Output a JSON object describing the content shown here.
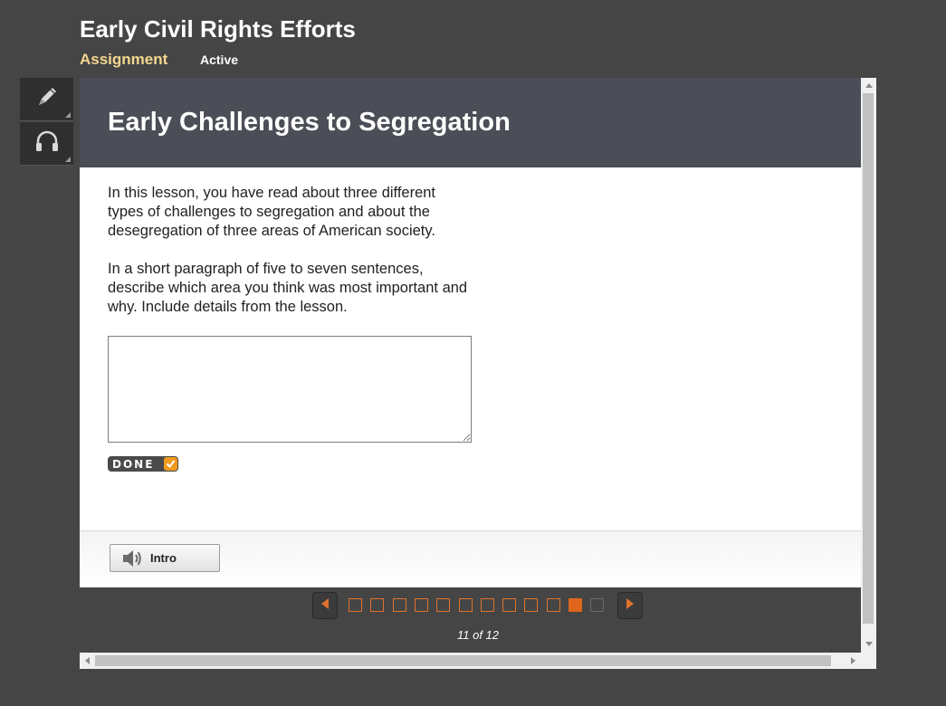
{
  "header": {
    "title": "Early Civil Rights Efforts",
    "assignment_label": "Assignment",
    "status": "Active"
  },
  "tools": {
    "items": [
      {
        "icon": "pencil-icon"
      },
      {
        "icon": "headphones-icon"
      }
    ]
  },
  "lesson": {
    "heading": "Early Challenges to Segregation",
    "paragraph1": "In this lesson, you have read about three different types of challenges to segregation and about the desegregation of three areas of American society.",
    "paragraph2": "In a short paragraph of five to seven sentences, describe which area you think was most important and why. Include details from the lesson.",
    "answer_value": "",
    "done_label": "DONE",
    "intro_label": "Intro"
  },
  "pager": {
    "total": 12,
    "current": 11,
    "count_text": "11 of 12"
  },
  "colors": {
    "background": "#454545",
    "banner": "#4b4e57",
    "accent_orange": "#e0661c",
    "assignment_gold": "#f4d68e"
  }
}
